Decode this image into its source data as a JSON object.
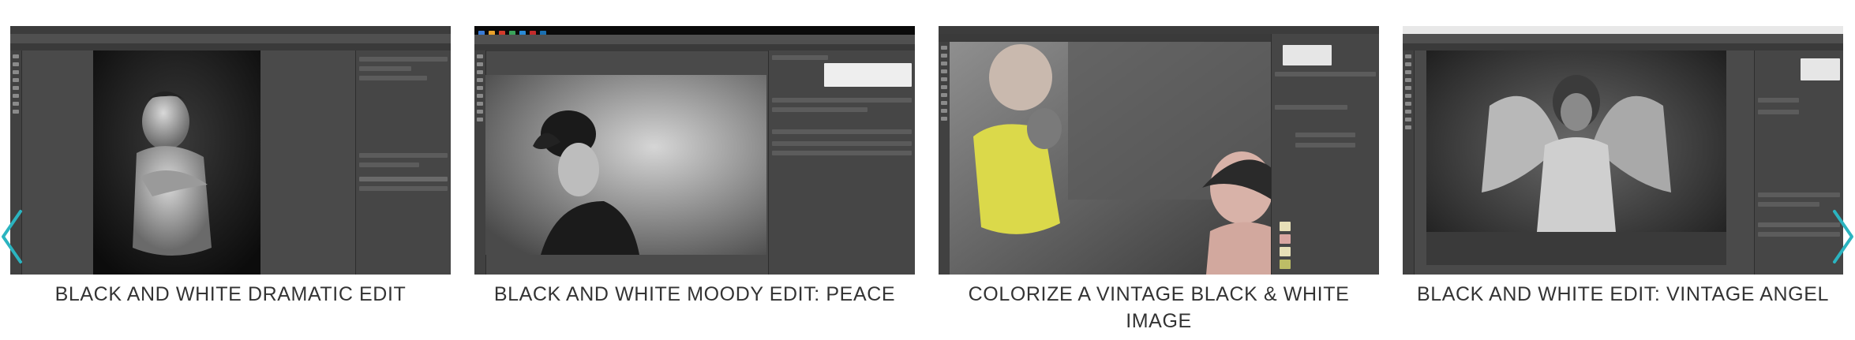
{
  "carousel": {
    "accent_color": "#2bb4c0",
    "prev_icon": "chevron-left-icon",
    "next_icon": "chevron-right-icon",
    "items": [
      {
        "caption": "BLACK AND WHITE DRAMATIC EDIT"
      },
      {
        "caption": "BLACK AND WHITE MOODY EDIT: PEACE"
      },
      {
        "caption": "COLORIZE A VINTAGE BLACK & WHITE IMAGE"
      },
      {
        "caption": "BLACK AND WHITE EDIT: VINTAGE ANGEL"
      }
    ]
  }
}
